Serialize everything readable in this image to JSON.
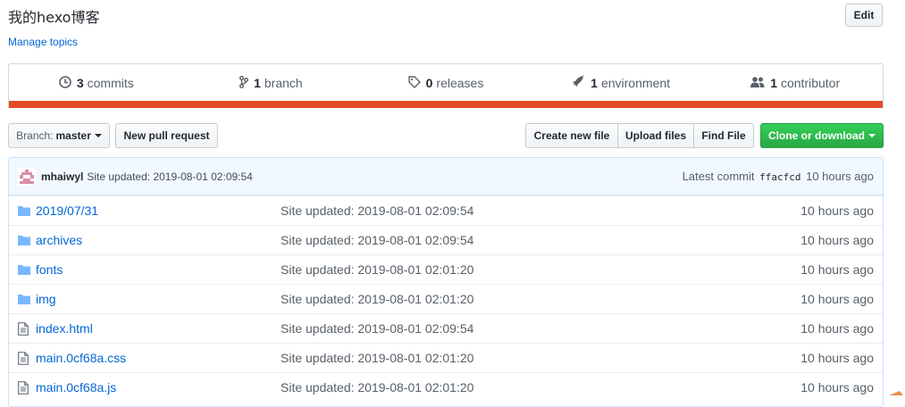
{
  "repo": {
    "description": "我的hexo博客",
    "manage_topics": "Manage topics",
    "edit_label": "Edit"
  },
  "summary": [
    {
      "icon": "history-icon",
      "count": "3",
      "label": "commits"
    },
    {
      "icon": "branch-icon",
      "count": "1",
      "label": "branch"
    },
    {
      "icon": "tag-icon",
      "count": "0",
      "label": "releases"
    },
    {
      "icon": "rocket-icon",
      "count": "1",
      "label": "environment"
    },
    {
      "icon": "people-icon",
      "count": "1",
      "label": "contributor"
    }
  ],
  "language_bar_color": "#e34c26",
  "toolbar": {
    "branch_prefix": "Branch:",
    "branch_name": "master",
    "new_pr": "New pull request",
    "create_file": "Create new file",
    "upload_files": "Upload files",
    "find_file": "Find File",
    "clone": "Clone or download"
  },
  "latest_commit": {
    "author": "mhaiwyl",
    "message": "Site updated: 2019-08-01 02:09:54",
    "prefix": "Latest commit",
    "sha": "ffacfcd",
    "age": "10 hours ago"
  },
  "files": [
    {
      "type": "folder",
      "name": "2019/07/31",
      "message": "Site updated: 2019-08-01 02:09:54",
      "age": "10 hours ago"
    },
    {
      "type": "folder",
      "name": "archives",
      "message": "Site updated: 2019-08-01 02:09:54",
      "age": "10 hours ago"
    },
    {
      "type": "folder",
      "name": "fonts",
      "message": "Site updated: 2019-08-01 02:01:20",
      "age": "10 hours ago"
    },
    {
      "type": "folder",
      "name": "img",
      "message": "Site updated: 2019-08-01 02:01:20",
      "age": "10 hours ago"
    },
    {
      "type": "file",
      "name": "index.html",
      "message": "Site updated: 2019-08-01 02:09:54",
      "age": "10 hours ago"
    },
    {
      "type": "file",
      "name": "main.0cf68a.css",
      "message": "Site updated: 2019-08-01 02:01:20",
      "age": "10 hours ago"
    },
    {
      "type": "file",
      "name": "main.0cf68a.js",
      "message": "Site updated: 2019-08-01 02:01:20",
      "age": "10 hours ago"
    }
  ]
}
